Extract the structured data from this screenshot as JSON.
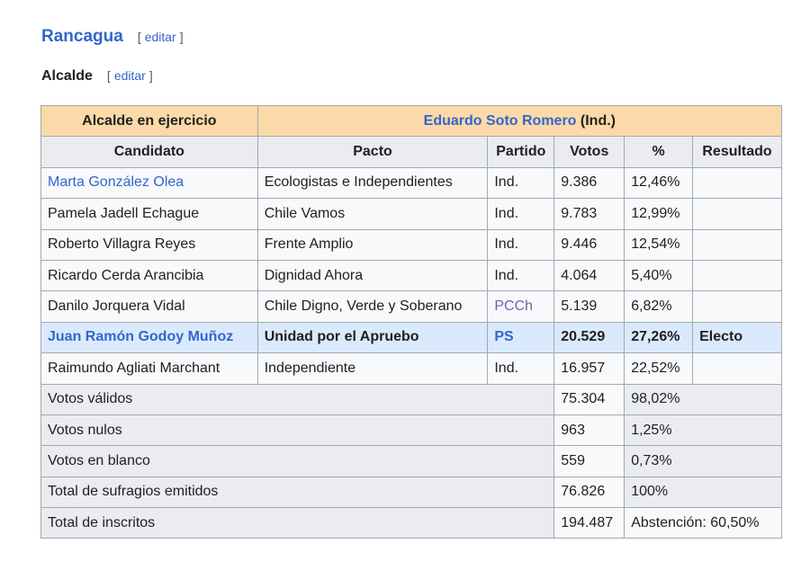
{
  "section": {
    "title": "Rancagua",
    "edit_open": "[",
    "edit_label": "editar",
    "edit_close": "]"
  },
  "subsection": {
    "title": "Alcalde",
    "edit_open": "[",
    "edit_label": "editar",
    "edit_close": "]"
  },
  "table": {
    "incumbent_label": "Alcalde en ejercicio",
    "incumbent_name": "Eduardo Soto Romero",
    "incumbent_party": "(Ind.)",
    "headers": [
      "Candidato",
      "Pacto",
      "Partido",
      "Votos",
      "%",
      "Resultado"
    ],
    "rows": [
      {
        "candidate": "Marta González Olea",
        "pact": "Ecologistas e Independientes",
        "party": "Ind.",
        "votes": "9.386",
        "pct": "12,46%",
        "result": ""
      },
      {
        "candidate": "Pamela Jadell Echague",
        "pact": "Chile Vamos",
        "party": "Ind.",
        "votes": "9.783",
        "pct": "12,99%",
        "result": ""
      },
      {
        "candidate": "Roberto Villagra Reyes",
        "pact": "Frente Amplio",
        "party": "Ind.",
        "votes": "9.446",
        "pct": "12,54%",
        "result": ""
      },
      {
        "candidate": "Ricardo Cerda Arancibia",
        "pact": "Dignidad Ahora",
        "party": "Ind.",
        "votes": "4.064",
        "pct": "5,40%",
        "result": ""
      },
      {
        "candidate": "Danilo Jorquera Vidal",
        "pact": "Chile Digno, Verde y Soberano",
        "party": "PCCh",
        "votes": "5.139",
        "pct": "6,82%",
        "result": ""
      },
      {
        "candidate": "Juan Ramón Godoy Muñoz",
        "pact": "Unidad por el Apruebo",
        "party": "PS",
        "votes": "20.529",
        "pct": "27,26%",
        "result": "Electo"
      },
      {
        "candidate": "Raimundo Agliati Marchant",
        "pact": "Independiente",
        "party": "Ind.",
        "votes": "16.957",
        "pct": "22,52%",
        "result": ""
      }
    ],
    "summary": [
      {
        "label": "Votos válidos",
        "votes": "75.304",
        "pct": "98,02%"
      },
      {
        "label": "Votos nulos",
        "votes": "963",
        "pct": "1,25%"
      },
      {
        "label": "Votos en blanco",
        "votes": "559",
        "pct": "0,73%"
      },
      {
        "label": "Total de sufragios emitidos",
        "votes": "76.826",
        "pct": "100%"
      },
      {
        "label": "Total de inscritos",
        "votes": "194.487",
        "pct": "Abstención: 60,50%"
      }
    ]
  },
  "colors": {
    "link": "#3366cc",
    "pcch": "#795cb2",
    "incumbent_bg": "#fcd9a8",
    "winner_bg": "#dbe9fc"
  }
}
